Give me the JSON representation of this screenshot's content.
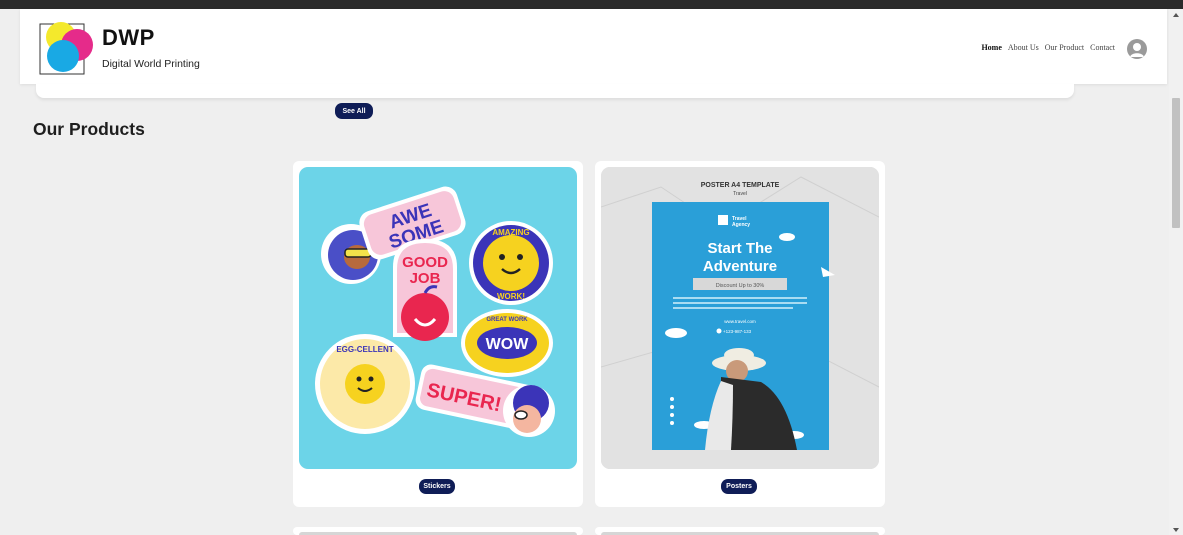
{
  "header": {
    "logo_title": "DWP",
    "logo_subtitle": "Digital World Printing",
    "nav": [
      "Home",
      "About Us",
      "Our Product",
      "Contact"
    ],
    "active_nav": "Home"
  },
  "see_all_label": "See All",
  "section_title": "Our Products",
  "products": [
    {
      "label": "Stickers",
      "stickers": [
        "AWE",
        "SOME",
        "GOOD",
        "JOB",
        "AMAZING",
        "WORK!",
        "WOW",
        "GREAT WORK",
        "EGG-CELLENT",
        "SUPER!"
      ]
    },
    {
      "label": "Posters",
      "poster_heading": "POSTER A4 TEMPLATE",
      "poster_sub": "Travel",
      "poster_brand_line1": "Travel",
      "poster_brand_line2": "Agency",
      "poster_title_1": "Start The",
      "poster_title_2": "Adventure",
      "poster_discount": "Discount Up to 30%",
      "poster_site": "www.travel.com",
      "poster_phone": "+123-987-133"
    }
  ],
  "colors": {
    "pill": "#0f1d57",
    "sticker_bg": "#6cd4e8",
    "poster_blue": "#2a9fd8"
  }
}
